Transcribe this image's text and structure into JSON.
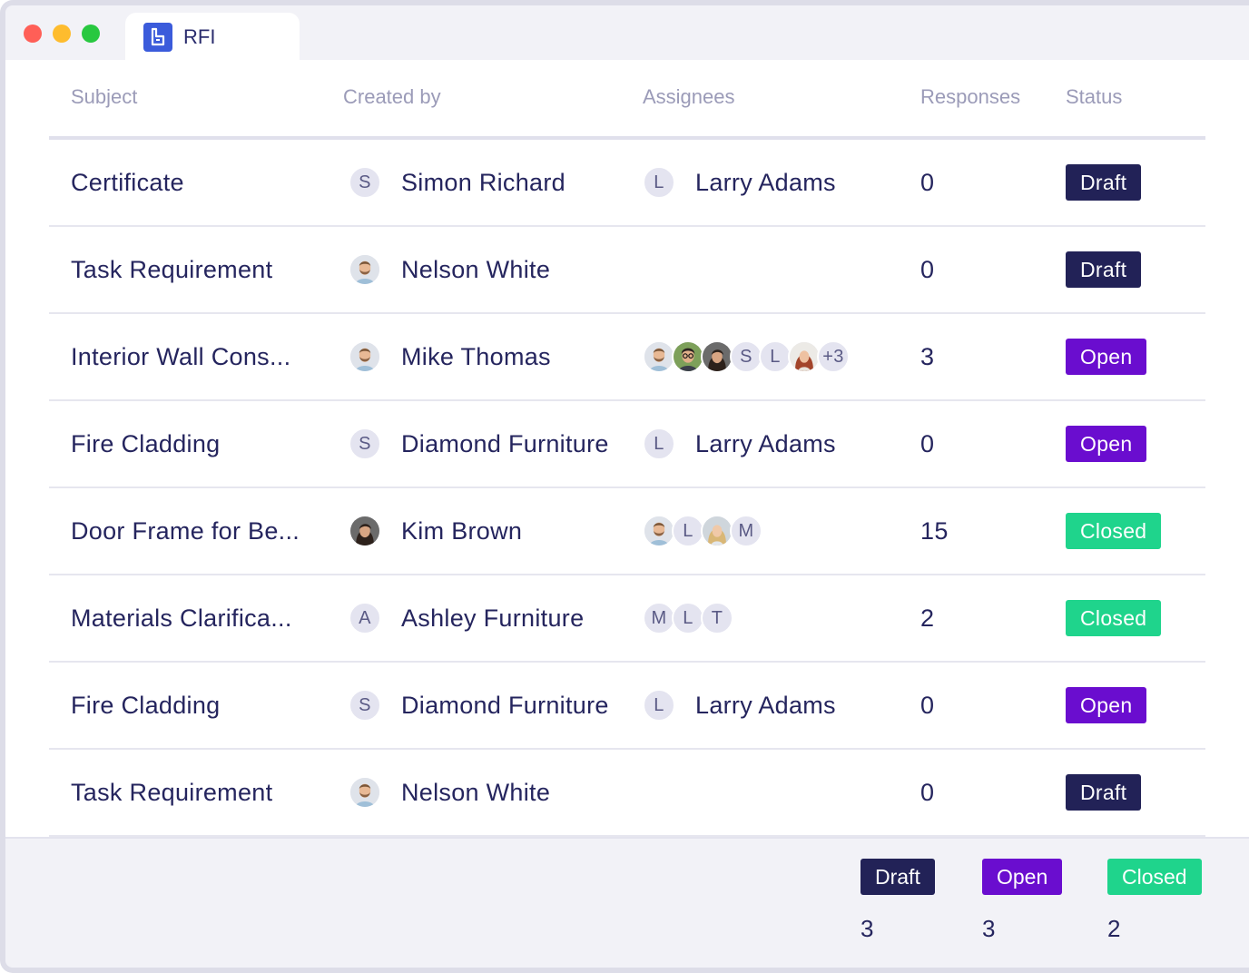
{
  "window": {
    "tab_title": "RFI",
    "tab_icon": "app-logo-icon"
  },
  "columns": {
    "subject": "Subject",
    "created_by": "Created by",
    "assignees": "Assignees",
    "responses": "Responses",
    "status": "Status"
  },
  "rows": [
    {
      "subject": "Certificate",
      "creator": {
        "name": "Simon Richard",
        "initial": "S"
      },
      "assignees": [
        {
          "initial": "L"
        }
      ],
      "assignee_name": "Larry Adams",
      "responses": "0",
      "status": "Draft"
    },
    {
      "subject": "Task Requirement",
      "creator": {
        "name": "Nelson White",
        "photo": "man-beard"
      },
      "assignees": [],
      "assignee_name": "",
      "responses": "0",
      "status": "Draft"
    },
    {
      "subject": "Interior Wall Cons...",
      "creator": {
        "name": "Mike Thomas",
        "photo": "man-beard"
      },
      "assignees": [
        {
          "photo": "man-beard"
        },
        {
          "photo": "man-glasses"
        },
        {
          "photo": "woman-dark"
        },
        {
          "initial": "S"
        },
        {
          "initial": "L"
        },
        {
          "photo": "woman-red"
        },
        {
          "initial": "+3"
        }
      ],
      "assignee_name": "",
      "responses": "3",
      "status": "Open"
    },
    {
      "subject": "Fire Cladding",
      "creator": {
        "name": "Diamond Furniture",
        "initial": "S"
      },
      "assignees": [
        {
          "initial": "L"
        }
      ],
      "assignee_name": "Larry Adams",
      "responses": "0",
      "status": "Open"
    },
    {
      "subject": "Door Frame for Be...",
      "creator": {
        "name": "Kim Brown",
        "photo": "woman-dark"
      },
      "assignees": [
        {
          "photo": "man-beard"
        },
        {
          "initial": "L"
        },
        {
          "photo": "woman-blonde"
        },
        {
          "initial": "M"
        }
      ],
      "assignee_name": "",
      "responses": "15",
      "status": "Closed"
    },
    {
      "subject": "Materials Clarifica...",
      "creator": {
        "name": "Ashley Furniture",
        "initial": "A"
      },
      "assignees": [
        {
          "initial": "M"
        },
        {
          "initial": "L"
        },
        {
          "initial": "T"
        }
      ],
      "assignee_name": "",
      "responses": "2",
      "status": "Closed"
    },
    {
      "subject": "Fire Cladding",
      "creator": {
        "name": "Diamond Furniture",
        "initial": "S"
      },
      "assignees": [
        {
          "initial": "L"
        }
      ],
      "assignee_name": "Larry Adams",
      "responses": "0",
      "status": "Open"
    },
    {
      "subject": "Task Requirement",
      "creator": {
        "name": "Nelson White",
        "photo": "man-beard"
      },
      "assignees": [],
      "assignee_name": "",
      "responses": "0",
      "status": "Draft"
    }
  ],
  "summary": [
    {
      "label": "Draft",
      "count": "3"
    },
    {
      "label": "Open",
      "count": "3"
    },
    {
      "label": "Closed",
      "count": "2"
    }
  ],
  "colors": {
    "draft": "#222257",
    "open": "#6a0dcf",
    "closed": "#1fd48c",
    "text": "#25255e",
    "header_text": "#9b9bb8"
  }
}
